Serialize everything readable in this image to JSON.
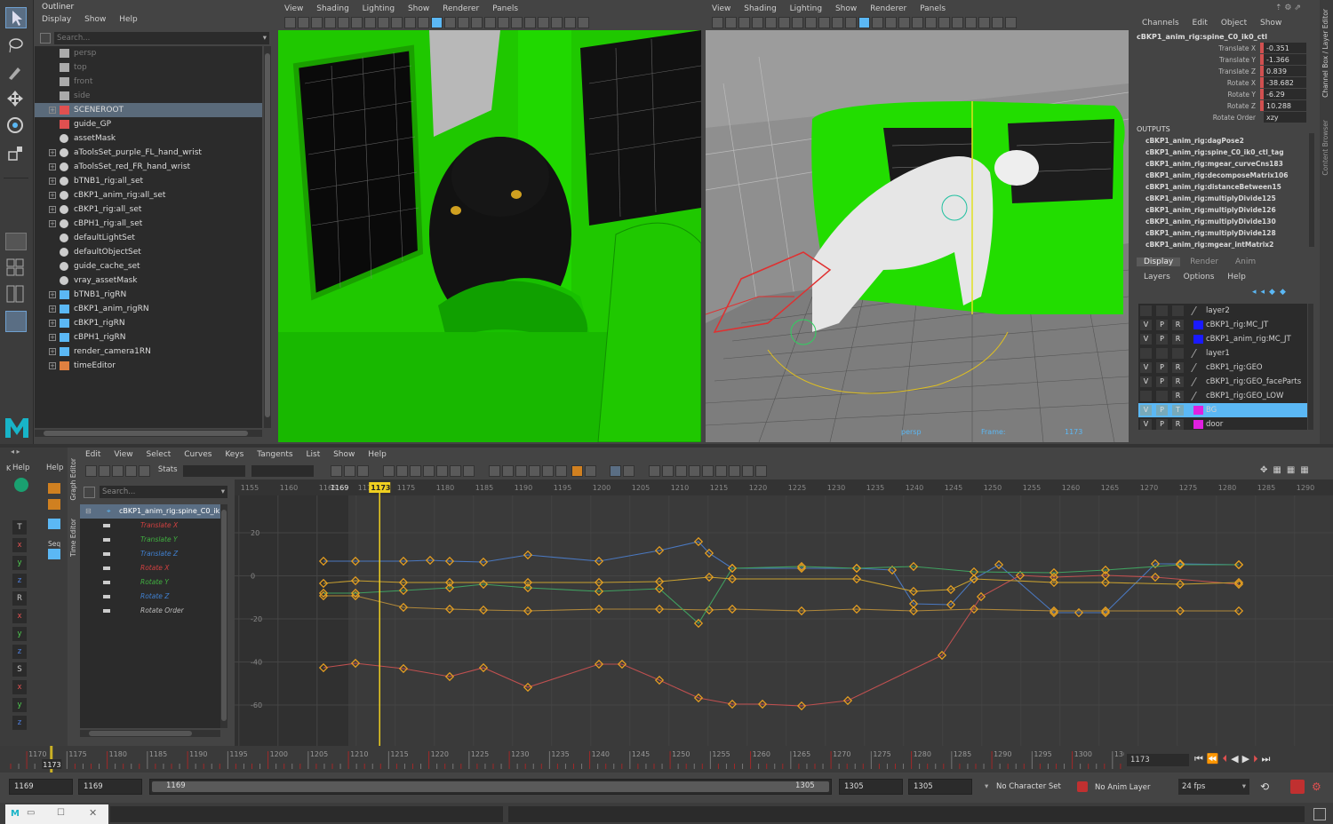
{
  "outliner": {
    "title": "Outliner",
    "menu": [
      "Display",
      "Show",
      "Help"
    ],
    "search_placeholder": "Search...",
    "items": [
      {
        "label": "persp",
        "icon": "camera-icon",
        "dim": true,
        "exp": false
      },
      {
        "label": "top",
        "icon": "camera-icon",
        "dim": true,
        "exp": false
      },
      {
        "label": "front",
        "icon": "camera-icon",
        "dim": true,
        "exp": false
      },
      {
        "label": "side",
        "icon": "camera-icon",
        "dim": true,
        "exp": false
      },
      {
        "label": "SCENEROOT",
        "icon": "curve-icon",
        "dim": false,
        "exp": true,
        "selected": true
      },
      {
        "label": "guide_GP",
        "icon": "curve-icon",
        "dim": false,
        "exp": false
      },
      {
        "label": "assetMask",
        "icon": "set-icon",
        "dim": false,
        "exp": false
      },
      {
        "label": "aToolsSet_purple_FL_hand_wrist",
        "icon": "set-icon",
        "dim": false,
        "exp": true
      },
      {
        "label": "aToolsSet_red_FR_hand_wrist",
        "icon": "set-icon",
        "dim": false,
        "exp": true
      },
      {
        "label": "bTNB1_rig:all_set",
        "icon": "set-icon",
        "dim": false,
        "exp": true
      },
      {
        "label": "cBKP1_anim_rig:all_set",
        "icon": "set-icon",
        "dim": false,
        "exp": true
      },
      {
        "label": "cBKP1_rig:all_set",
        "icon": "set-icon",
        "dim": false,
        "exp": true
      },
      {
        "label": "cBPH1_rig:all_set",
        "icon": "set-icon",
        "dim": false,
        "exp": true
      },
      {
        "label": "defaultLightSet",
        "icon": "set-icon",
        "dim": false,
        "exp": false
      },
      {
        "label": "defaultObjectSet",
        "icon": "set-icon",
        "dim": false,
        "exp": false
      },
      {
        "label": "guide_cache_set",
        "icon": "set-icon",
        "dim": false,
        "exp": false
      },
      {
        "label": "vray_assetMask",
        "icon": "set-icon",
        "dim": false,
        "exp": false
      },
      {
        "label": "bTNB1_rigRN",
        "icon": "reference-icon",
        "dim": false,
        "exp": true
      },
      {
        "label": "cBKP1_anim_rigRN",
        "icon": "reference-icon",
        "dim": false,
        "exp": true
      },
      {
        "label": "cBKP1_rigRN",
        "icon": "reference-icon",
        "dim": false,
        "exp": true
      },
      {
        "label": "cBPH1_rigRN",
        "icon": "reference-icon",
        "dim": false,
        "exp": true
      },
      {
        "label": "render_camera1RN",
        "icon": "reference-icon",
        "dim": false,
        "exp": true
      },
      {
        "label": "timeEditor",
        "icon": "time-editor-icon",
        "dim": false,
        "exp": true
      }
    ]
  },
  "viewport_menu": [
    "View",
    "Shading",
    "Lighting",
    "Show",
    "Renderer",
    "Panels"
  ],
  "viewport_right_hud": {
    "camera": "persp",
    "frame_label": "Frame:",
    "frame_value": "1173"
  },
  "channel_box": {
    "menu": [
      "Channels",
      "Edit",
      "Object",
      "Show"
    ],
    "node": "cBKP1_anim_rig:spine_C0_ik0_ctl",
    "channels": [
      {
        "label": "Translate X",
        "value": "-0.351"
      },
      {
        "label": "Translate Y",
        "value": "-1.366"
      },
      {
        "label": "Translate Z",
        "value": "0.839"
      },
      {
        "label": "Rotate X",
        "value": "-38.682"
      },
      {
        "label": "Rotate Y",
        "value": "-6.29"
      },
      {
        "label": "Rotate Z",
        "value": "10.288"
      },
      {
        "label": "Rotate Order",
        "value": "xzy"
      }
    ],
    "outputs_label": "OUTPUTS",
    "outputs": [
      "cBKP1_anim_rig:dagPose2",
      "cBKP1_anim_rig:spine_C0_ik0_ctl_tag",
      "cBKP1_anim_rig:mgear_curveCns183",
      "cBKP1_anim_rig:decomposeMatrix106",
      "cBKP1_anim_rig:distanceBetween15",
      "cBKP1_anim_rig:multiplyDivide125",
      "cBKP1_anim_rig:multiplyDivide126",
      "cBKP1_anim_rig:multiplyDivide130",
      "cBKP1_anim_rig:multiplyDivide128",
      "cBKP1_anim_rig:mgear_intMatrix2"
    ],
    "side_tabs": [
      "Channel Box / Layer Editor",
      "Content Browser"
    ]
  },
  "layer_editor": {
    "tabs": [
      "Display",
      "Render",
      "Anim"
    ],
    "menu": [
      "Layers",
      "Options",
      "Help"
    ],
    "layers": [
      {
        "v": "",
        "p": "",
        "r": "",
        "name": "layer2",
        "color": ""
      },
      {
        "v": "V",
        "p": "P",
        "r": "R",
        "name": "cBKP1_rig:MC_JT",
        "color": "#1a1aff"
      },
      {
        "v": "V",
        "p": "P",
        "r": "R",
        "name": "cBKP1_anim_rig:MC_JT",
        "color": "#1a1aff"
      },
      {
        "v": "",
        "p": "",
        "r": "",
        "name": "layer1",
        "color": ""
      },
      {
        "v": "V",
        "p": "P",
        "r": "R",
        "name": "cBKP1_rig:GEO",
        "color": ""
      },
      {
        "v": "V",
        "p": "P",
        "r": "R",
        "name": "cBKP1_rig:GEO_faceParts",
        "color": ""
      },
      {
        "v": "",
        "p": "",
        "r": "R",
        "name": "cBKP1_rig:GEO_LOW",
        "color": ""
      },
      {
        "v": "V",
        "p": "P",
        "r": "T",
        "name": "BG",
        "color": "#e020e0",
        "selected": true
      },
      {
        "v": "V",
        "p": "P",
        "r": "R",
        "name": "door",
        "color": "#e020e0"
      }
    ]
  },
  "graph_editor": {
    "menu": [
      "Edit",
      "View",
      "Select",
      "Curves",
      "Keys",
      "Tangents",
      "List",
      "Show",
      "Help"
    ],
    "stats_label": "Stats",
    "search_placeholder": "Search...",
    "left_help": "Help",
    "left_k": "K",
    "side_tabs": [
      "Graph Editor",
      "Time Editor"
    ],
    "seq_label": "Seq",
    "object": "cBKP1_anim_rig:spine_C0_ik",
    "channels": [
      {
        "label": "Translate X",
        "color": "#d04040"
      },
      {
        "label": "Translate Y",
        "color": "#40b040"
      },
      {
        "label": "Translate Z",
        "color": "#4080d0"
      },
      {
        "label": "Rotate X",
        "color": "#d04040"
      },
      {
        "label": "Rotate Y",
        "color": "#40b040"
      },
      {
        "label": "Rotate Z",
        "color": "#4080d0"
      },
      {
        "label": "Rotate Order",
        "color": "#bbbbbb"
      }
    ],
    "ruler_frames": [
      "1155",
      "1160",
      "1165",
      "1169",
      "1170",
      "1173",
      "1175",
      "1180",
      "1185",
      "1190",
      "1195",
      "1200",
      "1205",
      "1210",
      "1215",
      "1220",
      "1225",
      "1230",
      "1235",
      "1240",
      "1245",
      "1250",
      "1255",
      "1260",
      "1265",
      "1270",
      "1275",
      "1280",
      "1285",
      "1290"
    ],
    "current_frame": "1173",
    "start_marker": "1169",
    "y_labels": [
      "20",
      "0",
      "-20",
      "-40",
      "-60"
    ],
    "side_buttons": [
      "T",
      "x",
      "y",
      "z",
      "R",
      "x",
      "y",
      "z",
      "S",
      "x",
      "y",
      "z"
    ]
  },
  "time_slider": {
    "ticks": [
      "1170",
      "1175",
      "1180",
      "1185",
      "1190",
      "1195",
      "1200",
      "1205",
      "1210",
      "1215",
      "1220",
      "1225",
      "1230",
      "1235",
      "1240",
      "1245",
      "1250",
      "1255",
      "1260",
      "1265",
      "1270",
      "1275",
      "1280",
      "1285",
      "1290",
      "1295",
      "1300",
      "130"
    ],
    "current_frame_label": "1173",
    "current_frame_field": "1173"
  },
  "range_slider": {
    "start": "1169",
    "playback_start": "1169",
    "range_start": "1169",
    "range_end": "1305",
    "playback_end": "1305",
    "end": "1305",
    "character_set": "No Character Set",
    "anim_layer": "No Anim Layer",
    "fps": "24 fps"
  },
  "colors": {
    "viewport_green": "#22dd00",
    "accent": "#5bb8f5",
    "current_time": "#f0d020"
  }
}
